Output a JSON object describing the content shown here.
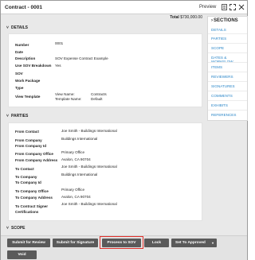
{
  "window": {
    "title": "Contract - 0001",
    "preview_label": "Preview"
  },
  "total": {
    "label": "Total",
    "value": "$730,000.00"
  },
  "sections_nav": {
    "title": "SECTIONS",
    "items": [
      "DETAILS",
      "PARTIES",
      "SCOPE",
      "DATES & WORKFLOW",
      "ITEMS",
      "REVIEWERS",
      "SIGNATURES",
      "COMMENTS",
      "EXHIBITS",
      "REFERENCES"
    ]
  },
  "details": {
    "header": "DETAILS",
    "fields": {
      "number_label": "Number",
      "number_value": "0001",
      "date_label": "Date",
      "description_label": "Description",
      "description_value": "SOV Expense Contract Example",
      "use_sov_label": "Use SOV Breakdown",
      "use_sov_value": "Yes",
      "sov_label": "SOV",
      "work_package_label": "Work Package",
      "type_label": "Type",
      "view_template_label": "View Template",
      "view_name_label": "View Name:",
      "view_name_value": "Contracts",
      "template_name_label": "Template Name:",
      "template_name_value": "Default"
    }
  },
  "parties": {
    "header": "PARTIES",
    "fields": {
      "from_contact_label": "From Contact",
      "from_contact_value": "Joe Smith - Buildings International",
      "from_company_label": "From Company",
      "from_company_value": "Buildings International",
      "from_company_id_label": "From Company Id",
      "from_company_office_label": "From Company Office",
      "from_company_office_value": "Primary Office",
      "from_company_address_label": "From Company Address",
      "from_company_address_value": "Avalon, CA 90704",
      "to_contact_label": "To Contact",
      "to_contact_value": "Joe Smith - Buildings International",
      "to_company_label": "To Company",
      "to_company_value": "Buildings International",
      "to_company_id_label": "To Company Id",
      "to_company_office_label": "To Company Office",
      "to_company_office_value": "Primary Office",
      "to_company_address_label": "To Company Address",
      "to_company_address_value": "Avalon, CA 90704",
      "to_contract_signer_label": "To Contract Signer",
      "to_contract_signer_label2": "Certifications",
      "to_contract_signer_value": "Joe Smith - Buildings International"
    }
  },
  "scope": {
    "header": "SCOPE"
  },
  "toolbar": {
    "submit_review": "Submit for Review",
    "submit_signature": "Submit for Signature",
    "process_sov": "Process to SOV",
    "lock": "Lock",
    "set_to_approved": "Set To Approved",
    "void": "Void"
  },
  "colors": {
    "accent_link": "#2a86c8",
    "button_bg": "#5a5a5a",
    "highlight": "#e0302b"
  }
}
